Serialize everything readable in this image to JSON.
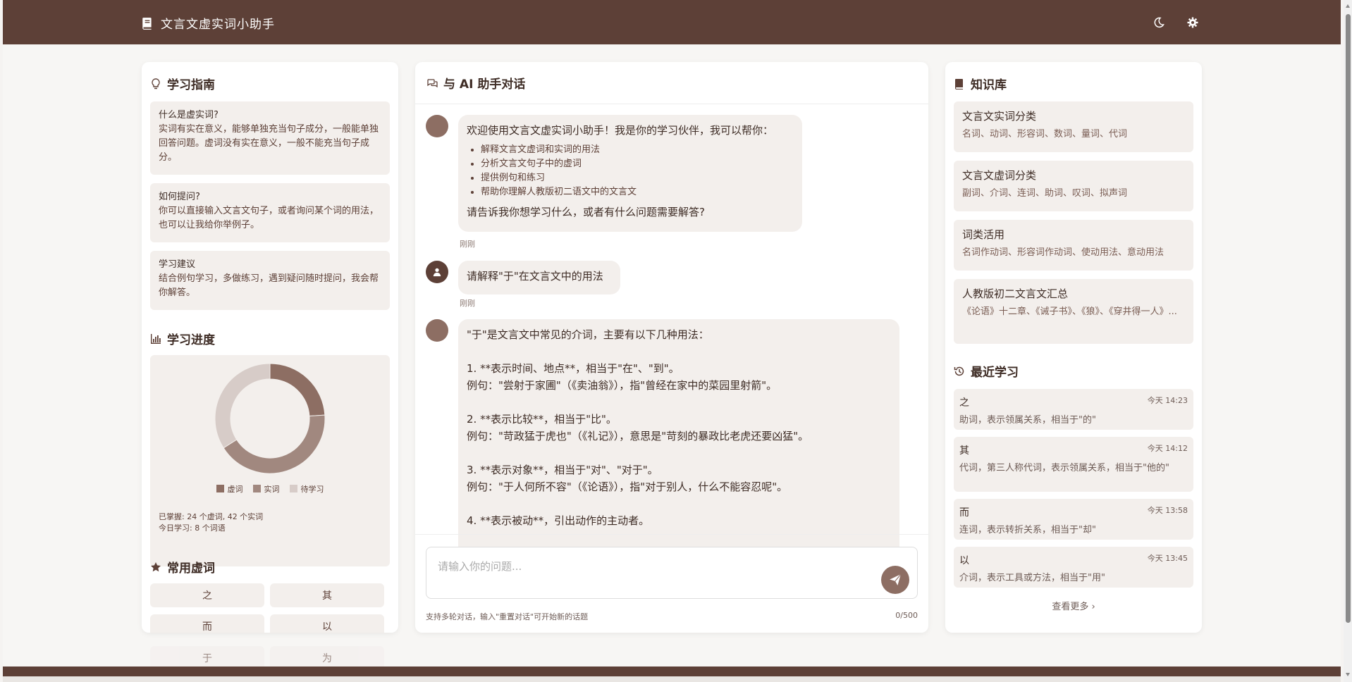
{
  "app": {
    "title": "文言文虚实词小助手"
  },
  "guide": {
    "title": "学习指南",
    "cards": [
      {
        "heading": "什么是虚实词?",
        "text": "实词有实在意义，能够单独充当句子成分，一般能单独回答问题。虚词没有实在意义，一般不能充当句子成分。"
      },
      {
        "heading": "如何提问?",
        "text": "你可以直接输入文言文句子，或者询问某个词的用法，也可以让我给你举例子。"
      },
      {
        "heading": "学习建议",
        "text": "结合例句学习，多做练习，遇到疑问随时提问，我会帮你解答。"
      }
    ]
  },
  "progress": {
    "title": "学习进度",
    "legend": [
      "虚词",
      "实词",
      "待学习"
    ],
    "summary_line1": "已掌握: 24 个虚词, 42 个实词",
    "summary_line2": "今日学习: 8 个词语"
  },
  "chart_data": {
    "type": "pie",
    "categories": [
      "虚词",
      "实词",
      "待学习"
    ],
    "values": [
      24,
      42,
      34
    ],
    "colors": [
      "#8d6e63",
      "#a1887f",
      "#d7ccc8"
    ],
    "title": ""
  },
  "common_words": {
    "title": "常用虚词",
    "items": [
      "之",
      "其",
      "而",
      "以",
      "于",
      "为"
    ]
  },
  "chat": {
    "title": "与 AI 助手对话",
    "welcome": {
      "intro": "欢迎使用文言文虚实词小助手！我是你的学习伙伴，我可以帮你：",
      "bullets": [
        "解释文言文虚词和实词的用法",
        "分析文言文句子中的虚词",
        "提供例句和练习",
        "帮助你理解人教版初二语文中的文言文"
      ],
      "outro": "请告诉我你想学习什么，或者有什么问题需要解答?",
      "time": "刚刚"
    },
    "user_msg": {
      "text": "请解释\"于\"在文言文中的用法",
      "time": "刚刚"
    },
    "reply_lines": [
      "\"于\"是文言文中常见的介词，主要有以下几种用法：",
      "",
      "1. **表示时间、地点**，相当于\"在\"、\"到\"。",
      "例句：\"尝射于家圃\"（《卖油翁》），指\"曾经在家中的菜园里射箭\"。",
      "",
      "2. **表示比较**，相当于\"比\"。",
      "例句：\"苛政猛于虎也\"（《礼记》），意思是\"苛刻的暴政比老虎还要凶猛\"。",
      "",
      "3. **表示对象**，相当于\"对\"、\"对于\"。",
      "例句：\"于人何所不容\"（《论语》），指\"对于别人，什么不能容忍呢\"。",
      "",
      "4. **表示被动**，引出动作的主动者。"
    ],
    "input_placeholder": "请输入你的问题...",
    "hint": "支持多轮对话，输入\"重置对话\"可开始新的话题",
    "counter": "0/500"
  },
  "knowledge": {
    "title": "知识库",
    "cards": [
      {
        "title": "文言文实词分类",
        "desc": "名词、动词、形容词、数词、量词、代词"
      },
      {
        "title": "文言文虚词分类",
        "desc": "副词、介词、连词、助词、叹词、拟声词"
      },
      {
        "title": "词类活用",
        "desc": "名词作动词、形容词作动词、使动用法、意动用法"
      },
      {
        "title": "人教版初二文言文汇总",
        "desc": "《论语》十二章、《诫子书》、《狼》、《穿井得一人》..."
      }
    ]
  },
  "recent": {
    "title": "最近学习",
    "items": [
      {
        "word": "之",
        "time": "今天 14:23",
        "meaning": "助词，表示领属关系，相当于\"的\""
      },
      {
        "word": "其",
        "time": "今天 14:12",
        "meaning": "代词，第三人称代词，表示领属关系，相当于\"他的\""
      },
      {
        "word": "而",
        "time": "今天 13:58",
        "meaning": "连词，表示转折关系，相当于\"却\""
      },
      {
        "word": "以",
        "time": "今天 13:45",
        "meaning": "介词，表示工具或方法，相当于\"用\""
      }
    ],
    "more_label": "查看更多 ›"
  }
}
